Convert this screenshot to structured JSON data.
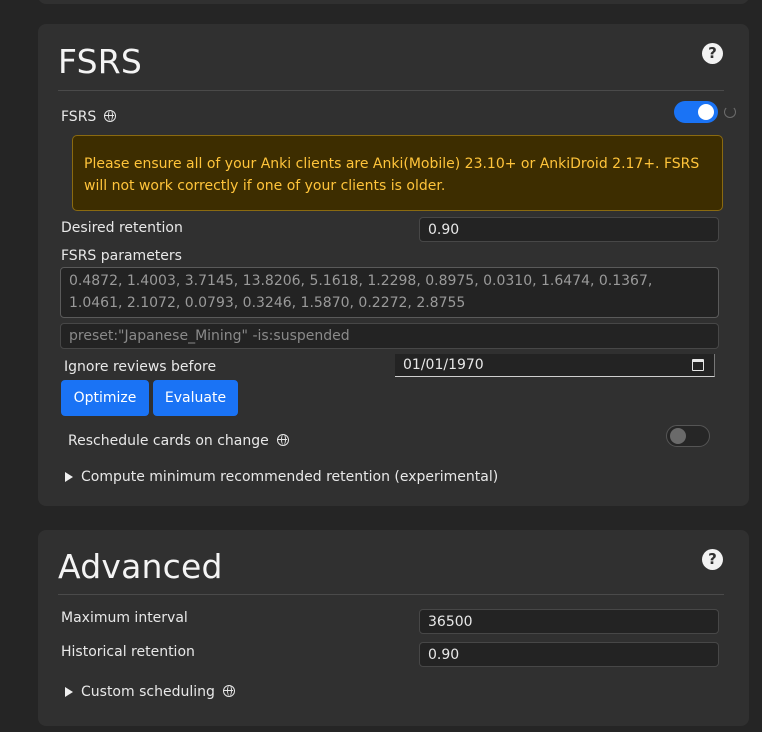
{
  "fsrs_section": {
    "title": "FSRS",
    "help_icon": "question-mark-icon",
    "fsrs_toggle": {
      "label": "FSRS",
      "on": true
    },
    "warning": "Please ensure all of your Anki clients are Anki(Mobile) 23.10+ or AnkiDroid 2.17+. FSRS will not work correctly if one of your clients is older.",
    "desired_retention": {
      "label": "Desired retention",
      "value": "0.90"
    },
    "parameters": {
      "label": "FSRS parameters",
      "value": "0.4872, 1.4003, 3.7145, 13.8206, 5.1618, 1.2298, 0.8975, 0.0310, 1.6474, 0.1367, 1.0461, 2.1072, 0.0793, 0.3246, 1.5870, 0.2272, 2.8755"
    },
    "search_query": "preset:\"Japanese_Mining\" -is:suspended",
    "ignore_reviews": {
      "label": "Ignore reviews before",
      "value": "01/01/1970"
    },
    "optimize_button": "Optimize",
    "evaluate_button": "Evaluate",
    "reschedule": {
      "label": "Reschedule cards on change",
      "on": false
    },
    "compute_min_retention": "Compute minimum recommended retention (experimental)"
  },
  "advanced_section": {
    "title": "Advanced",
    "help_icon": "question-mark-icon",
    "maximum_interval": {
      "label": "Maximum interval",
      "value": "36500"
    },
    "historical_retention": {
      "label": "Historical retention",
      "value": "0.90"
    },
    "custom_scheduling": "Custom scheduling"
  },
  "colors": {
    "accent": "#1a73f5",
    "warning_text": "#ffc43a",
    "warning_bg": "#3d2d00",
    "card_bg": "#303030",
    "page_bg": "#252525"
  }
}
